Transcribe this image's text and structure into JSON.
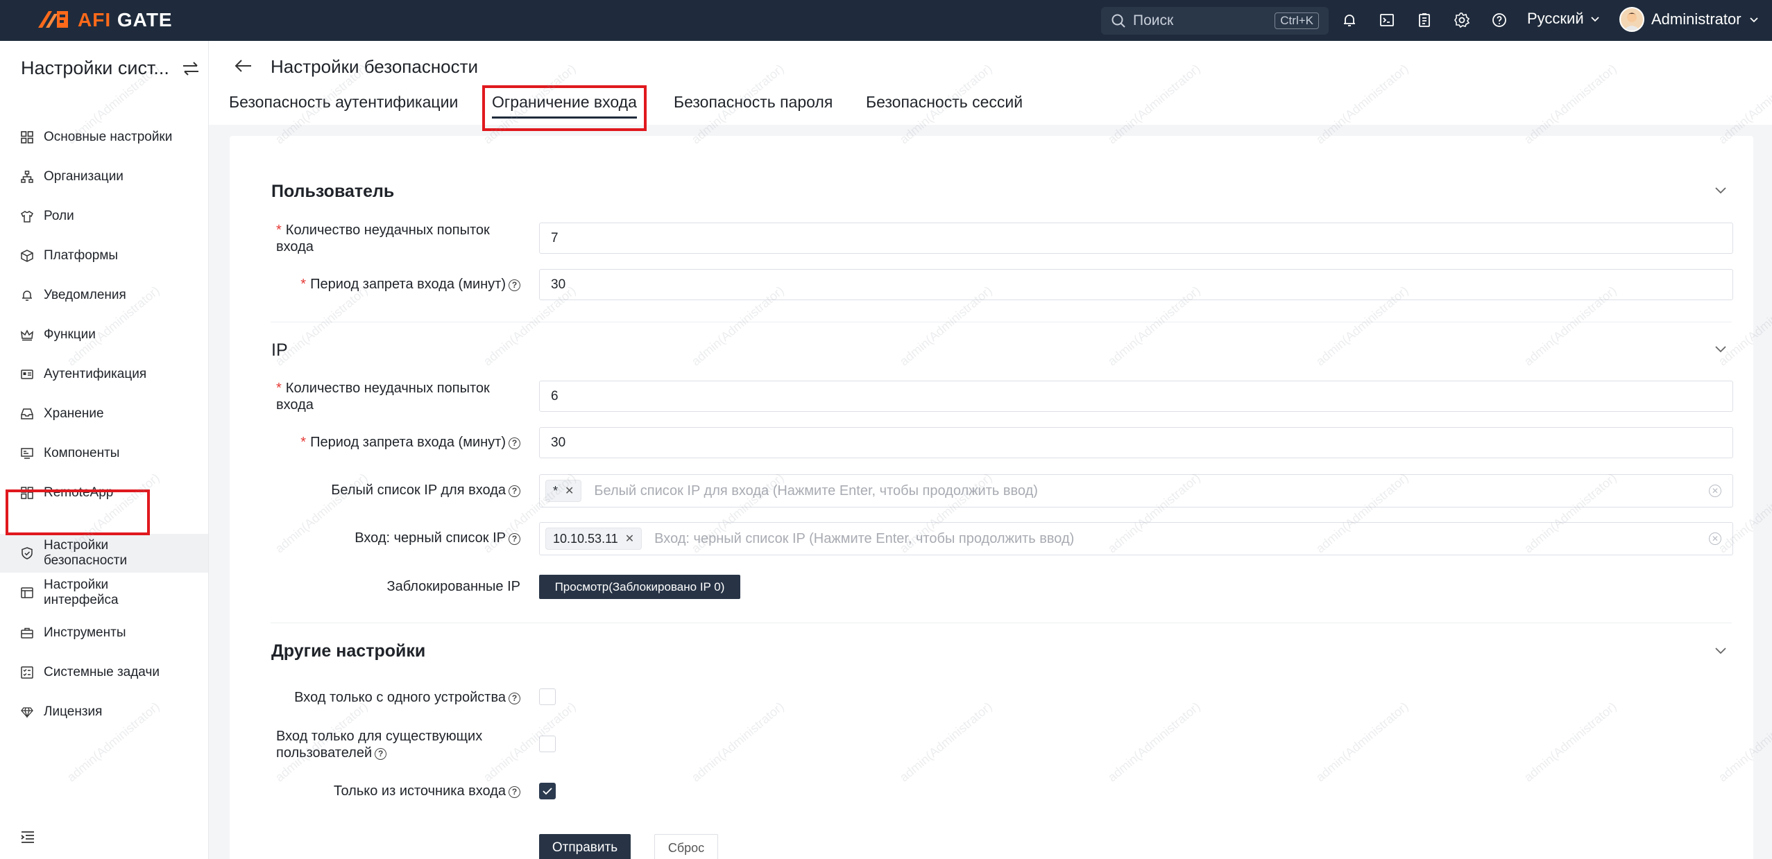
{
  "topbar": {
    "logo_afi": "AFI",
    "logo_gate": "GATE",
    "search_placeholder": "Поиск",
    "search_shortcut": "Ctrl+K",
    "language": "Русский",
    "username": "Administrator",
    "icons": [
      "bell-icon",
      "terminal-icon",
      "clipboard-icon",
      "gear-icon",
      "help-icon"
    ]
  },
  "sidebar": {
    "title": "Настройки сист...",
    "items": [
      {
        "label": "Основные настройки",
        "icon": "grid-icon"
      },
      {
        "label": "Организации",
        "icon": "org-icon"
      },
      {
        "label": "Роли",
        "icon": "shirt-icon"
      },
      {
        "label": "Платформы",
        "icon": "cube-icon"
      },
      {
        "label": "Уведомления",
        "icon": "bell-icon"
      },
      {
        "label": "Функции",
        "icon": "crown-icon"
      },
      {
        "label": "Аутентификация",
        "icon": "id-card-icon"
      },
      {
        "label": "Хранение",
        "icon": "inbox-icon"
      },
      {
        "label": "Компоненты",
        "icon": "monitor-icon"
      },
      {
        "label": "RemoteApp",
        "icon": "apps-icon"
      },
      {
        "label": "Настройки безопасности",
        "icon": "shield-icon",
        "active": true
      },
      {
        "label": "Настройки интерфейса",
        "icon": "window-icon"
      },
      {
        "label": "Инструменты",
        "icon": "toolbox-icon"
      },
      {
        "label": "Системные задачи",
        "icon": "tasks-icon"
      },
      {
        "label": "Лицензия",
        "icon": "diamond-icon"
      }
    ]
  },
  "page": {
    "title": "Настройки безопасности",
    "tabs": [
      {
        "label": "Безопасность аутентификации"
      },
      {
        "label": "Ограничение входа",
        "active": true
      },
      {
        "label": "Безопасность пароля"
      },
      {
        "label": "Безопасность сессий"
      }
    ]
  },
  "user_section": {
    "title": "Пользователь",
    "failed_attempts_label": "Количество неудачных попыток входа",
    "failed_attempts_value": "7",
    "ban_period_label": "Период запрета входа (минут)",
    "ban_period_value": "30"
  },
  "ip_section": {
    "title": "IP",
    "failed_attempts_label": "Количество неудачных попыток входа",
    "failed_attempts_value": "6",
    "ban_period_label": "Период запрета входа (минут)",
    "ban_period_value": "30",
    "whitelist_label": "Белый список IP для входа",
    "whitelist_tags": [
      "*"
    ],
    "whitelist_placeholder": "Белый список IP для входа (Нажмите Enter, чтобы продолжить ввод)",
    "blacklist_label": "Вход: черный список IP",
    "blacklist_tags": [
      "10.10.53.11"
    ],
    "blacklist_placeholder": "Вход: черный список IP (Нажмите Enter, чтобы продолжить ввод)",
    "blocked_label": "Заблокированные IP",
    "blocked_button": "Просмотр(Заблокировано IP 0)"
  },
  "other_section": {
    "title": "Другие настройки",
    "single_device_label": "Вход только с одного устройства",
    "single_device_checked": false,
    "existing_users_label": "Вход только для существующих пользователей",
    "existing_users_checked": false,
    "source_only_label": "Только из источника входа",
    "source_only_checked": true
  },
  "actions": {
    "submit": "Отправить",
    "reset": "Сброс"
  },
  "watermark_text": "admin(Administrator)",
  "colors": {
    "topbar": "#1f2b3c",
    "brand_orange": "#ff6a1a",
    "primary_button": "#283446",
    "highlight": "#e0191e",
    "required": "#e53935"
  }
}
